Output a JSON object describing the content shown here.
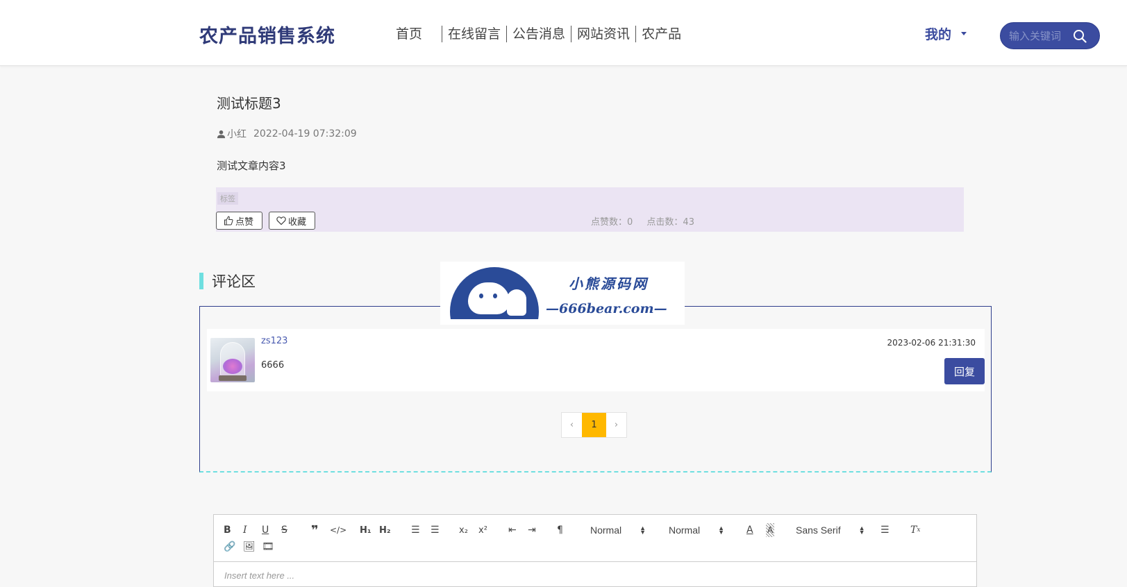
{
  "header": {
    "site_title": "农产品销售系统",
    "nav": [
      "首页",
      "在线留言",
      "公告消息",
      "网站资讯",
      "农产品"
    ],
    "mine": "我的",
    "search_placeholder": "输入关键词"
  },
  "article": {
    "title": "测试标题3",
    "author": "小红",
    "date": "2022-04-19 07:32:09",
    "content": "测试文章内容3",
    "tag_label": "标签",
    "like_label": "点赞",
    "fav_label": "收藏",
    "like_count_text": "点赞数：0",
    "click_count_text": "点击数：43"
  },
  "comments": {
    "section_title": "评论区",
    "items": [
      {
        "user": "zs123",
        "text": "6666",
        "date": "2023-02-06 21:31:30",
        "reply_label": "回复"
      }
    ],
    "pager": {
      "prev": "‹",
      "current": "1",
      "next": "›"
    }
  },
  "watermark": {
    "name": "小熊源码网",
    "url": "—666bear.com—"
  },
  "editor": {
    "header_select": "Normal",
    "size_select": "Normal",
    "font_select": "Sans Serif",
    "placeholder": "Insert text here ..."
  },
  "colors": {
    "primary": "#3b4ca0",
    "accent": "#6fdfe0",
    "pager_active": "#ffb800",
    "tag_bg": "#ebe4f3"
  }
}
